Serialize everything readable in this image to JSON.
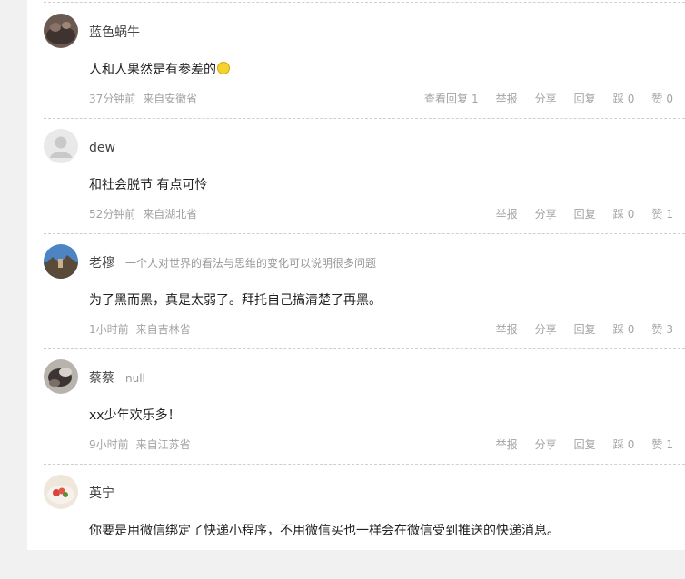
{
  "actions": {
    "view_replies_label": "查看回复",
    "report_label": "举报",
    "share_label": "分享",
    "reply_label": "回复",
    "dislike_label": "踩",
    "like_label": "赞"
  },
  "comments": [
    {
      "username": "蓝色蜗牛",
      "signature": "",
      "content": "人和人果然是有参差的",
      "content_emoji": "smile",
      "time": "37分钟前",
      "location": "来自安徽省",
      "replies_count": "1",
      "dislikes": "0",
      "likes": "0"
    },
    {
      "username": "dew",
      "signature": "",
      "content": "和社会脱节 有点可怜",
      "time": "52分钟前",
      "location": "来自湖北省",
      "dislikes": "0",
      "likes": "1"
    },
    {
      "username": "老穆",
      "signature": "一个人对世界的看法与思维的变化可以说明很多问题",
      "content": "为了黑而黑，真是太弱了。拜托自己搞清楚了再黑。",
      "time": "1小时前",
      "location": "来自吉林省",
      "dislikes": "0",
      "likes": "3"
    },
    {
      "username": "蔡蔡",
      "signature": "null",
      "content": "xx少年欢乐多！",
      "time": "9小时前",
      "location": "来自江苏省",
      "dislikes": "0",
      "likes": "1"
    },
    {
      "username": "英宁",
      "signature": "",
      "content": "你要是用微信绑定了快递小程序，不用微信买也一样会在微信受到推送的快递消息。"
    }
  ],
  "colors": {
    "page_bg": "#f1f1f1",
    "panel_bg": "#ffffff",
    "meta_text": "#a3a3a3",
    "divider": "#cfcfcf"
  }
}
